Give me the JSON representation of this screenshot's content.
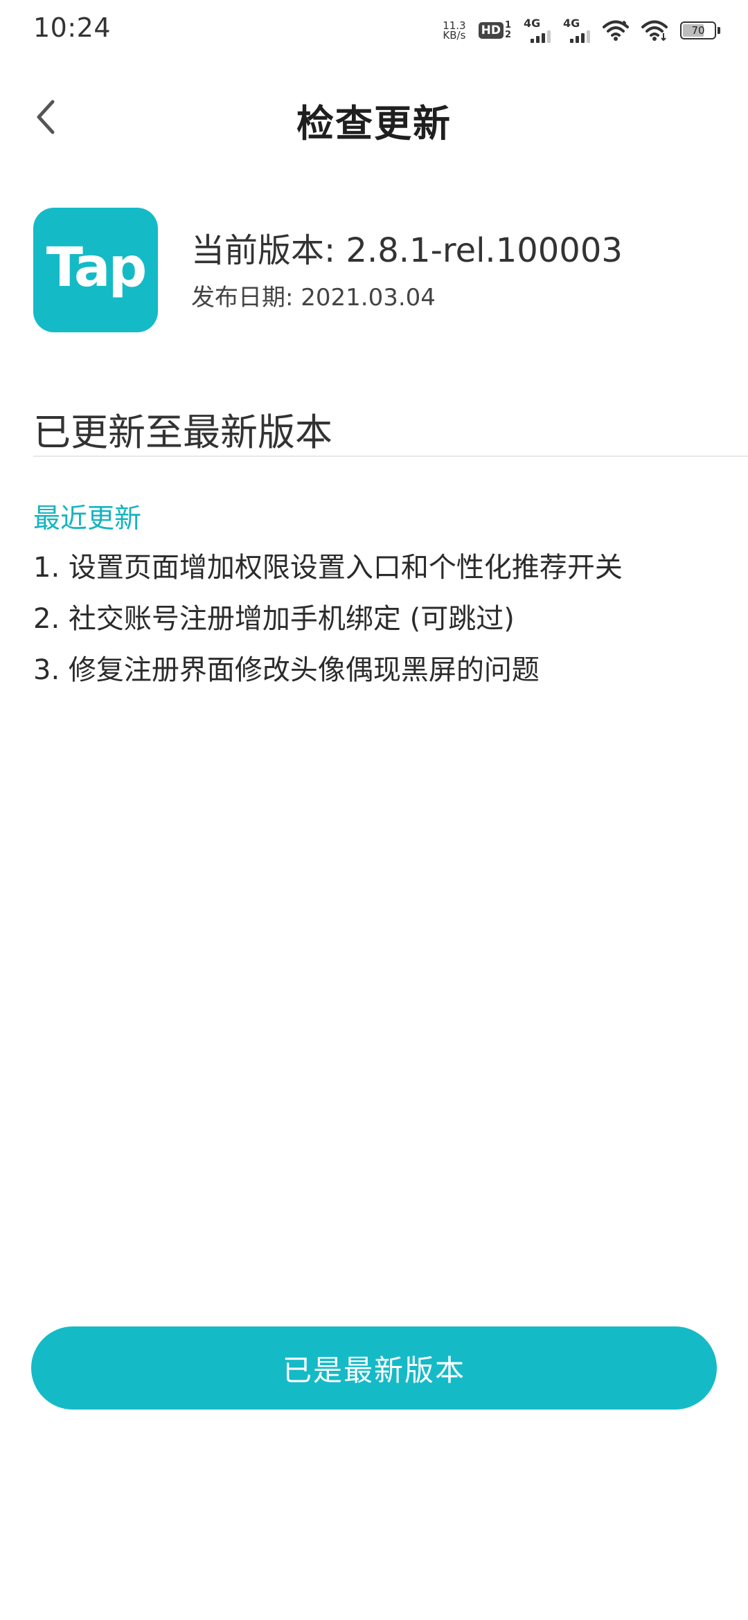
{
  "status_bar": {
    "time": "10:24",
    "net_speed_value": "11.3",
    "net_speed_unit": "KB/s",
    "hd_label": "HD",
    "hd_sim_top": "1",
    "hd_sim_bottom": "2",
    "sim1_type": "4G",
    "sim2_type": "4G",
    "battery_level": "70",
    "battery_fraction": 0.7,
    "icons": [
      "hd-icon",
      "signal-icon",
      "signal-icon",
      "wifi-icon",
      "wifi-icon",
      "battery-icon"
    ]
  },
  "header": {
    "title": "检查更新",
    "back_icon": "chevron-left-icon"
  },
  "app": {
    "icon_text": "Tap",
    "icon_color": "#15bac7",
    "version": "当前版本: 2.8.1-rel.100003",
    "release_date": "发布日期: 2021.03.04"
  },
  "update_status": "已更新至最新版本",
  "changelog": {
    "title": "最近更新",
    "items": [
      "1. 设置页面增加权限设置入口和个性化推荐开关",
      "2. 社交账号注册增加手机绑定 (可跳过)",
      "3. 修复注册界面修改头像偶现黑屏的问题"
    ]
  },
  "action": {
    "button_label": "已是最新版本"
  },
  "colors": {
    "accent": "#15bac7",
    "text_primary": "#222222"
  }
}
